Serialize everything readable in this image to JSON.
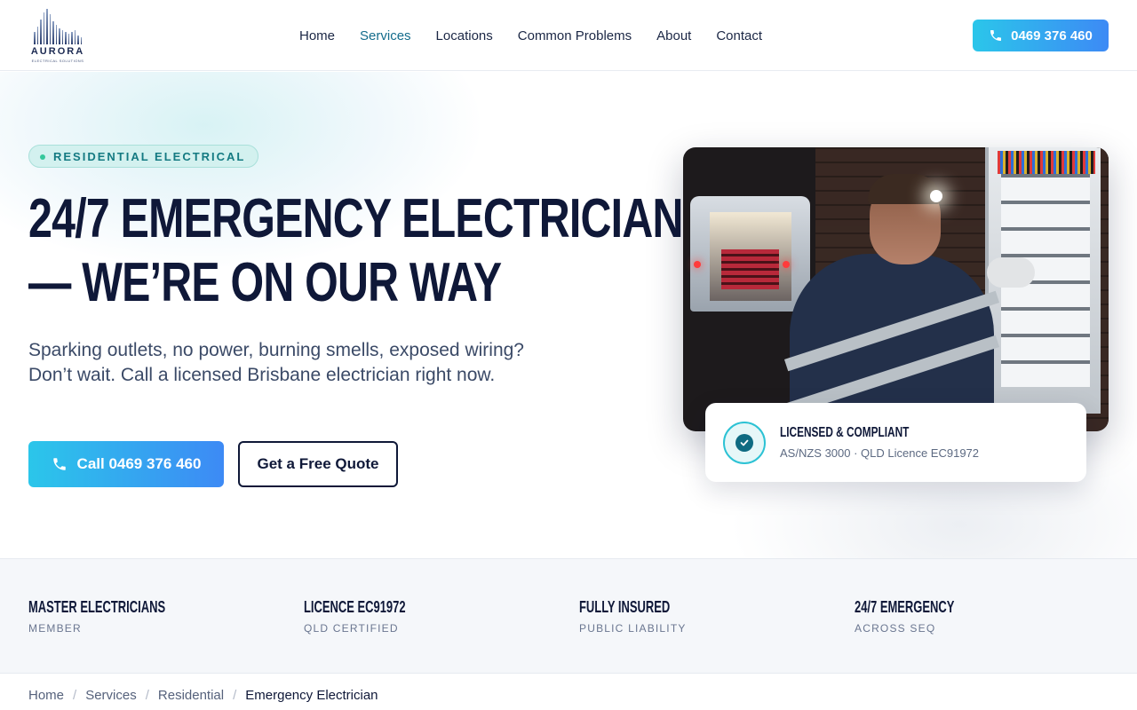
{
  "brand": {
    "name": "AURORA",
    "tagline": "ELECTRICAL SOLUTIONS"
  },
  "nav": {
    "items": [
      {
        "label": "Home",
        "active": false
      },
      {
        "label": "Services",
        "active": true
      },
      {
        "label": "Locations",
        "active": false
      },
      {
        "label": "Common Problems",
        "active": false
      },
      {
        "label": "About",
        "active": false
      },
      {
        "label": "Contact",
        "active": false
      }
    ],
    "call_button": {
      "label": "0469 376 460",
      "icon": "phone-icon"
    }
  },
  "hero": {
    "badge": "RESIDENTIAL ELECTRICAL",
    "title_line1": "24/7 Emergency Electrician",
    "title_line2": "— We’re On Our Way",
    "lead": "Sparking outlets, no power, burning smells, exposed wiring? Don’t wait. Call a licensed Brisbane electrician right now.",
    "primary_cta": "Call 0469 376 460",
    "secondary_cta": "Get a Free Quote"
  },
  "license_card": {
    "icon": "check-badge-icon",
    "title": "Licensed & Compliant",
    "subtitle": "AS/NZS 3000 · QLD Licence EC91972"
  },
  "trust": [
    {
      "title": "Master Electricians",
      "subtitle": "MEMBER"
    },
    {
      "title": "Licence EC91972",
      "subtitle": "QLD CERTIFIED"
    },
    {
      "title": "Fully Insured",
      "subtitle": "PUBLIC LIABILITY"
    },
    {
      "title": "24/7 Emergency",
      "subtitle": "ACROSS SEQ"
    }
  ],
  "breadcrumb": [
    "Home",
    "Services",
    "Residential",
    "Emergency Electrician"
  ],
  "colors": {
    "accent_start": "#2bc6ea",
    "accent_end": "#3d8af5",
    "navy": "#0f1838",
    "teal": "#146c8c"
  }
}
